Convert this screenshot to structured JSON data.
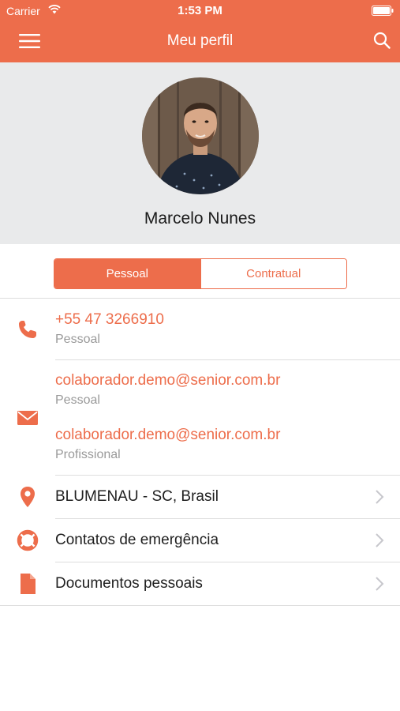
{
  "status_bar": {
    "carrier": "Carrier",
    "time": "1:53 PM"
  },
  "nav": {
    "title": "Meu perfil",
    "menu_icon": "hamburger-menu-icon",
    "search_icon": "search-icon"
  },
  "profile": {
    "name": "Marcelo Nunes"
  },
  "tabs": [
    {
      "label": "Pessoal",
      "selected": true
    },
    {
      "label": "Contratual",
      "selected": false
    }
  ],
  "phone": {
    "number": "+55 47 3266910",
    "type": "Pessoal",
    "icon": "phone-icon"
  },
  "emails": [
    {
      "address": "colaborador.demo@senior.com.br",
      "type": "Pessoal"
    },
    {
      "address": "colaborador.demo@senior.com.br",
      "type": "Profissional"
    }
  ],
  "email_icon": "envelope-icon",
  "items": [
    {
      "label": "BLUMENAU - SC, Brasil",
      "icon": "location-pin-icon"
    },
    {
      "label": "Contatos de emergência",
      "icon": "lifebuoy-icon"
    },
    {
      "label": "Documentos pessoais",
      "icon": "document-icon"
    }
  ],
  "colors": {
    "accent": "#ed6d4b",
    "profile_bg": "#e9eaeb",
    "secondary_text": "#9a9a9a"
  }
}
